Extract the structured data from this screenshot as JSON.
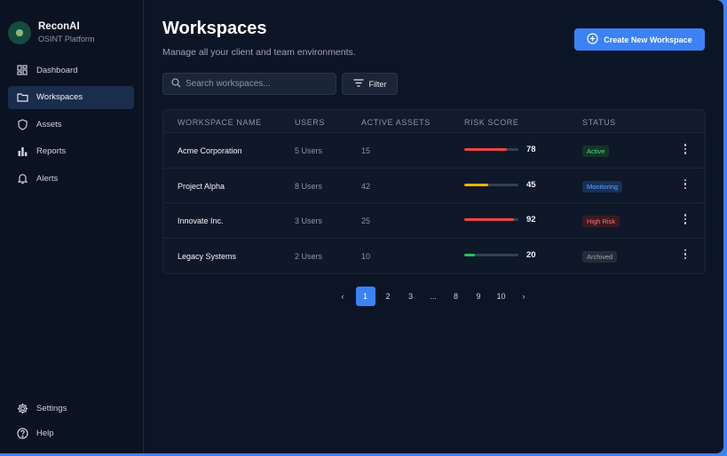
{
  "brand": {
    "name": "ReconAI",
    "subtitle": "OSINT Platform"
  },
  "nav": {
    "items": [
      {
        "label": "Dashboard",
        "icon": "dashboard-icon",
        "active": false
      },
      {
        "label": "Workspaces",
        "icon": "folder-icon",
        "active": true
      },
      {
        "label": "Assets",
        "icon": "shield-icon",
        "active": false
      },
      {
        "label": "Reports",
        "icon": "bar-chart-icon",
        "active": false
      },
      {
        "label": "Alerts",
        "icon": "bell-icon",
        "active": false
      }
    ],
    "bottom": [
      {
        "label": "Settings",
        "icon": "gear-icon"
      },
      {
        "label": "Help",
        "icon": "help-icon"
      }
    ]
  },
  "page": {
    "title": "Workspaces",
    "subtitle": "Manage all your client and team environments.",
    "create_label": "Create New Workspace"
  },
  "search": {
    "placeholder": "Search workspaces...",
    "value": ""
  },
  "filter": {
    "label": "Filter"
  },
  "table": {
    "columns": [
      "WORKSPACE NAME",
      "USERS",
      "ACTIVE ASSETS",
      "RISK SCORE",
      "STATUS"
    ],
    "rows": [
      {
        "name": "Acme Corporation",
        "users": "5 Users",
        "assets": "15",
        "risk": "78",
        "risk_fraction": 0.78,
        "risk_color": "#ef4444",
        "status": "Active",
        "status_bg": "#14342a",
        "status_fg": "#4ade80"
      },
      {
        "name": "Project Alpha",
        "users": "8 Users",
        "assets": "42",
        "risk": "45",
        "risk_fraction": 0.45,
        "risk_color": "#eab308",
        "status": "Monitoring",
        "status_bg": "#17305a",
        "status_fg": "#60a5fa"
      },
      {
        "name": "Innovate Inc.",
        "users": "3 Users",
        "assets": "25",
        "risk": "92",
        "risk_fraction": 0.92,
        "risk_color": "#ef4444",
        "status": "High Risk",
        "status_bg": "#3b1a22",
        "status_fg": "#f87171"
      },
      {
        "name": "Legacy Systems",
        "users": "2 Users",
        "assets": "10",
        "risk": "20",
        "risk_fraction": 0.2,
        "risk_color": "#22c55e",
        "status": "Archived",
        "status_bg": "#262d38",
        "status_fg": "#9ca3af"
      }
    ]
  },
  "pagination": {
    "prev": "‹",
    "next": "›",
    "pages": [
      "1",
      "2",
      "3",
      "...",
      "8",
      "9",
      "10"
    ],
    "current": "1"
  },
  "colors": {
    "accent": "#3b82f6",
    "background": "#0c1525",
    "sidebar": "#0b1322"
  }
}
